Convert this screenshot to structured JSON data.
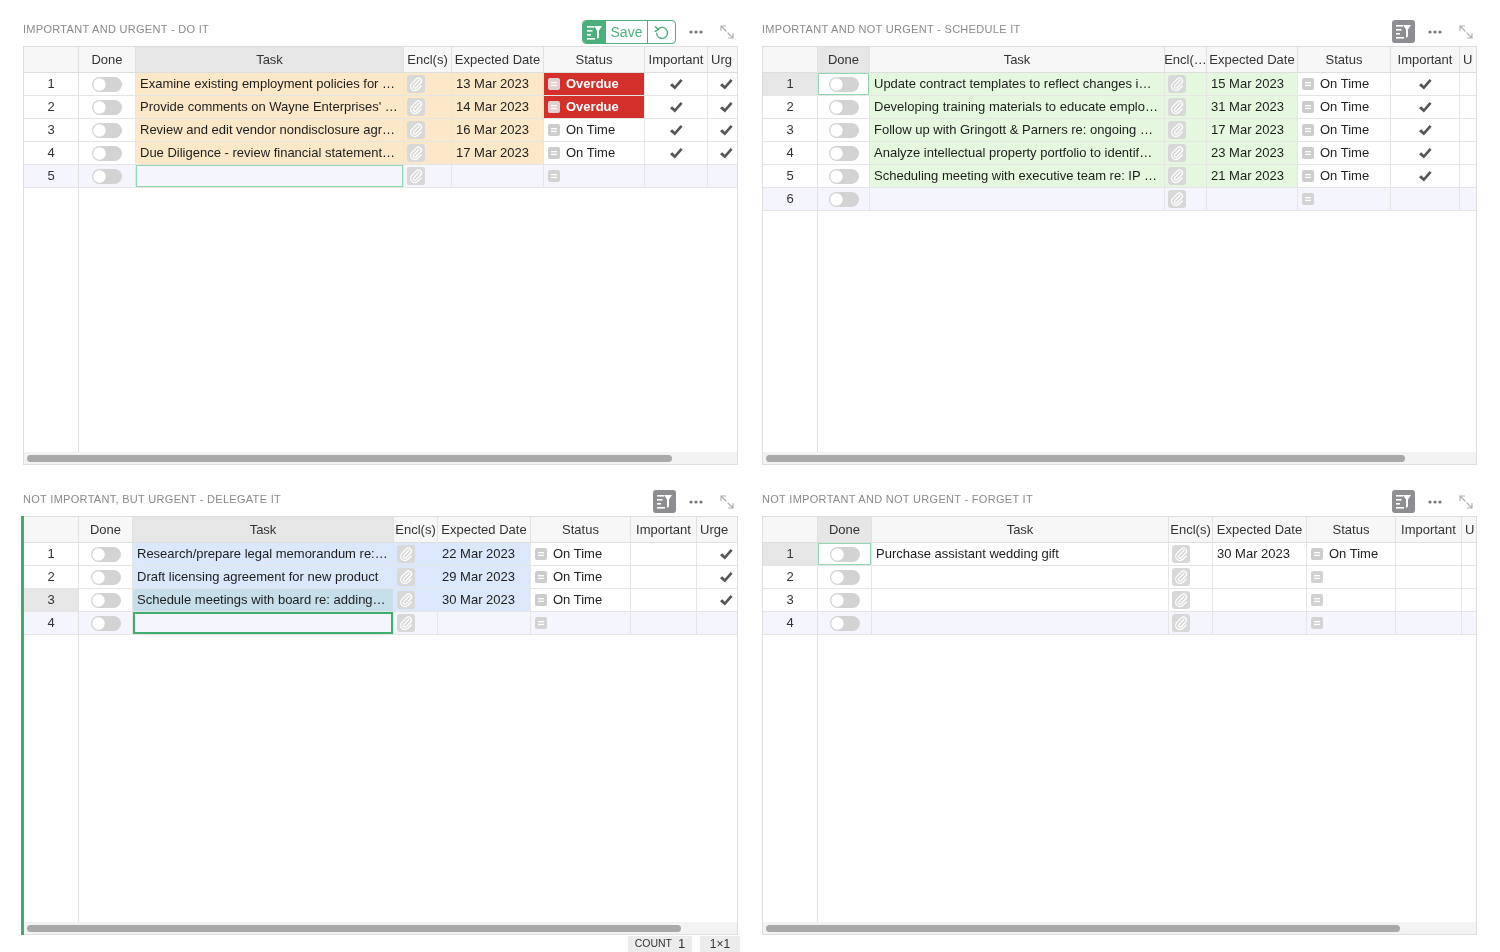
{
  "panels": [
    {
      "title": "IMPORTANT AND URGENT - DO IT",
      "active": false,
      "color": "#fbe8c9",
      "save_label": "Save",
      "columns": [
        {
          "label": "Done",
          "selected": false
        },
        {
          "label": "Task",
          "selected": true
        },
        {
          "label": "Encl(s)",
          "selected": false
        },
        {
          "label": "Expected Date",
          "selected": false
        },
        {
          "label": "Status",
          "selected": false
        },
        {
          "label": "Important",
          "selected": false
        },
        {
          "label": "Urg",
          "selected": false
        }
      ],
      "rows": [
        {
          "kind": "task",
          "number": "1",
          "done": false,
          "task": "Examine existing employment policies for …",
          "date": "13 Mar 2023",
          "status": {
            "kind": "overdue",
            "label": "Overdue"
          },
          "important": true,
          "urgent": true,
          "selected": false,
          "cursor": false
        },
        {
          "kind": "task",
          "number": "2",
          "done": false,
          "task": "Provide comments on Wayne Enterprises' …",
          "date": "14 Mar 2023",
          "status": {
            "kind": "overdue",
            "label": "Overdue"
          },
          "important": true,
          "urgent": true,
          "selected": false,
          "cursor": false
        },
        {
          "kind": "task",
          "number": "3",
          "done": false,
          "task": "Review and edit vendor nondisclosure agr…",
          "date": "16 Mar 2023",
          "status": {
            "kind": "on_time",
            "label": "On Time"
          },
          "important": true,
          "urgent": true,
          "selected": false,
          "cursor": false
        },
        {
          "kind": "task",
          "number": "4",
          "done": false,
          "task": "Due Diligence - review financial statement…",
          "date": "17 Mar 2023",
          "status": {
            "kind": "on_time",
            "label": "On Time"
          },
          "important": true,
          "urgent": true,
          "selected": false,
          "cursor": false
        },
        {
          "kind": "new",
          "number": "5",
          "done": false,
          "selected": false,
          "cursor": true
        }
      ]
    },
    {
      "title": "IMPORTANT AND NOT URGENT - SCHEDULE IT",
      "active": false,
      "color": "#e5f8df",
      "columns": [
        {
          "label": "Done",
          "selected": true
        },
        {
          "label": "Task",
          "selected": false
        },
        {
          "label": "Encl(…",
          "selected": false
        },
        {
          "label": "Expected Date",
          "selected": false
        },
        {
          "label": "Status",
          "selected": false
        },
        {
          "label": "Important",
          "selected": false
        },
        {
          "label": "U",
          "selected": false
        }
      ],
      "rows": [
        {
          "kind": "task",
          "number": "1",
          "done": false,
          "task": "Update contract templates to reflect changes i…",
          "date": "15 Mar 2023",
          "status": {
            "kind": "on_time",
            "label": "On Time"
          },
          "important": true,
          "urgent": false,
          "selected": true,
          "cursor": true
        },
        {
          "kind": "task",
          "number": "2",
          "done": false,
          "task": "Developing training materials to educate emplo…",
          "date": "31 Mar 2023",
          "status": {
            "kind": "on_time",
            "label": "On Time"
          },
          "important": true,
          "urgent": false,
          "selected": false,
          "cursor": false
        },
        {
          "kind": "task",
          "number": "3",
          "done": false,
          "task": "Follow up with Gringott & Parners re: ongoing …",
          "date": "17 Mar 2023",
          "status": {
            "kind": "on_time",
            "label": "On Time"
          },
          "important": true,
          "urgent": false,
          "selected": false,
          "cursor": false
        },
        {
          "kind": "task",
          "number": "4",
          "done": false,
          "task": "Analyze intellectual property portfolio to identif…",
          "date": "23 Mar 2023",
          "status": {
            "kind": "on_time",
            "label": "On Time"
          },
          "important": true,
          "urgent": false,
          "selected": false,
          "cursor": false
        },
        {
          "kind": "task",
          "number": "5",
          "done": false,
          "task": "Scheduling meeting with executive team re: IP …",
          "date": "21 Mar 2023",
          "status": {
            "kind": "on_time",
            "label": "On Time"
          },
          "important": true,
          "urgent": false,
          "selected": false,
          "cursor": false
        },
        {
          "kind": "new",
          "number": "6",
          "done": false,
          "selected": false,
          "cursor": false
        }
      ]
    },
    {
      "title": "NOT IMPORTANT, BUT URGENT - DELEGATE IT",
      "active": true,
      "color": "#dbe7fb",
      "columns": [
        {
          "label": "Done",
          "selected": false
        },
        {
          "label": "Task",
          "selected": true
        },
        {
          "label": "Encl(s)",
          "selected": false
        },
        {
          "label": "Expected Date",
          "selected": false
        },
        {
          "label": "Status",
          "selected": false
        },
        {
          "label": "Important",
          "selected": false
        },
        {
          "label": "Urge",
          "selected": false
        }
      ],
      "rows": [
        {
          "kind": "task",
          "number": "1",
          "done": false,
          "task": "Research/prepare legal memorandum re:…",
          "date": "22 Mar 2023",
          "status": {
            "kind": "on_time",
            "label": "On Time"
          },
          "important": false,
          "urgent": true,
          "selected": false,
          "cursor": false
        },
        {
          "kind": "task",
          "number": "2",
          "done": false,
          "task": "Draft licensing agreement for new product",
          "date": "29 Mar 2023",
          "status": {
            "kind": "on_time",
            "label": "On Time"
          },
          "important": false,
          "urgent": true,
          "selected": false,
          "cursor": false
        },
        {
          "kind": "task",
          "number": "3",
          "done": false,
          "task": "Schedule meetings with board re: adding…",
          "date": "30 Mar 2023",
          "status": {
            "kind": "on_time",
            "label": "On Time"
          },
          "important": false,
          "urgent": true,
          "selected": true,
          "cursor": false
        },
        {
          "kind": "new",
          "number": "4",
          "done": false,
          "selected": false,
          "cursor": true
        }
      ]
    },
    {
      "title": "NOT IMPORTANT AND NOT URGENT - FORGET IT",
      "active": false,
      "columns": [
        {
          "label": "Done",
          "selected": true
        },
        {
          "label": "Task",
          "selected": false
        },
        {
          "label": "Encl(s)",
          "selected": false
        },
        {
          "label": "Expected Date",
          "selected": false
        },
        {
          "label": "Status",
          "selected": false
        },
        {
          "label": "Important",
          "selected": false
        },
        {
          "label": "U",
          "selected": false
        }
      ],
      "rows": [
        {
          "kind": "task",
          "number": "1",
          "done": false,
          "task": "Purchase assistant wedding gift",
          "date": "30 Mar 2023",
          "status": {
            "kind": "on_time",
            "label": "On Time"
          },
          "important": false,
          "urgent": false,
          "selected": true,
          "cursor": true
        },
        {
          "kind": "task",
          "number": "2",
          "done": false,
          "important": false,
          "urgent": false,
          "selected": false,
          "cursor": false
        },
        {
          "kind": "task",
          "number": "3",
          "done": false,
          "important": false,
          "urgent": false,
          "selected": false,
          "cursor": false
        },
        {
          "kind": "new",
          "number": "4",
          "done": false,
          "selected": false,
          "cursor": false
        }
      ]
    }
  ],
  "status_bar": {
    "count_label": "COUNT",
    "count": "1",
    "selection_size": "1×1"
  }
}
